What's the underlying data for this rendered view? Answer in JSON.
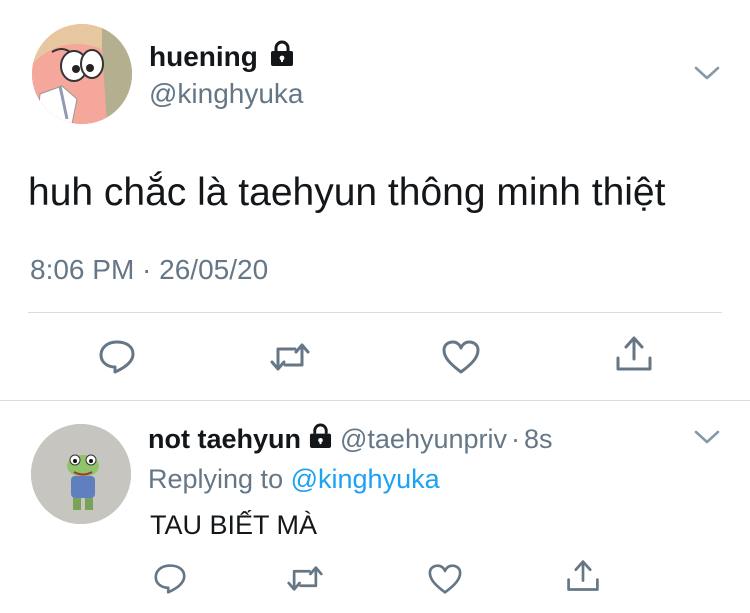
{
  "tweet": {
    "display_name": "huening",
    "handle": "@kinghyuka",
    "text": "huh chắc là taehyun thông minh thiệt",
    "timestamp": "8:06 PM · 26/05/20",
    "avatar": "patrick-star-avatar",
    "protected_icon": "lock-icon",
    "menu_icon": "chevron-down-icon",
    "actions": [
      "reply-icon",
      "retweet-icon",
      "like-icon",
      "share-icon"
    ]
  },
  "reply": {
    "display_name": "not taehyun",
    "handle": "@taehyunpriv",
    "separator": "·",
    "time_ago": "8s",
    "replying_prefix": "Replying to",
    "replying_to": "@kinghyuka",
    "text": "TAU BIẾT MÀ",
    "avatar": "frog-avatar",
    "protected_icon": "lock-icon",
    "menu_icon": "chevron-down-icon",
    "actions": [
      "reply-icon",
      "retweet-icon",
      "like-icon",
      "share-icon"
    ]
  },
  "colors": {
    "text": "#14171a",
    "secondary": "#657786",
    "link": "#1da1f2",
    "divider": "#d7dde2"
  }
}
